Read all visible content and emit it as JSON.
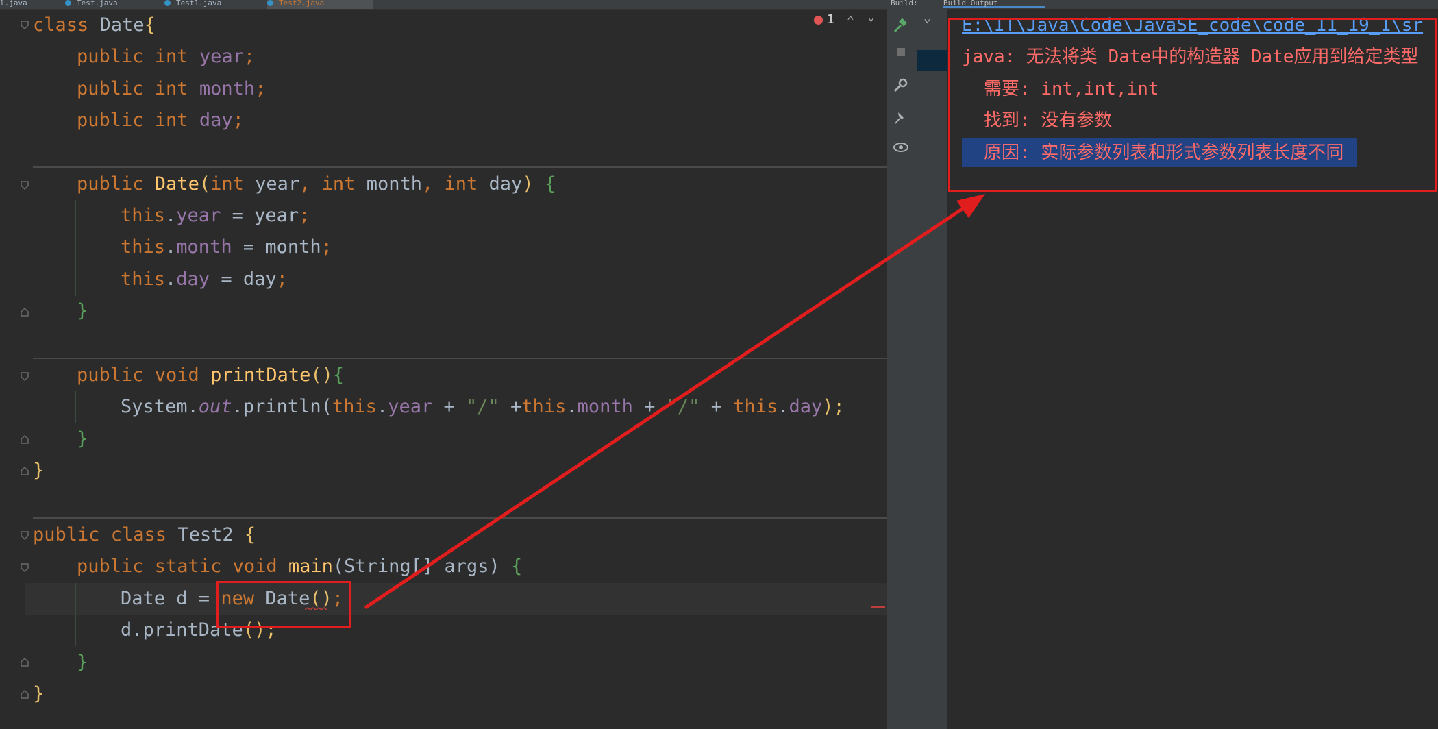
{
  "editor": {
    "tabs": [
      "l.java",
      "Test.java",
      "Test1.java",
      "Test2.java"
    ],
    "error_count": "1",
    "lines": {
      "l1": {
        "a": "class ",
        "b": "Date",
        "c": "{"
      },
      "l2": {
        "a": "public int ",
        "b": "year",
        "c": ";"
      },
      "l3": {
        "a": "public int ",
        "b": "month",
        "c": ";"
      },
      "l4": {
        "a": "public int ",
        "b": "day",
        "c": ";"
      },
      "l6": {
        "a": "public ",
        "b": "Date",
        "c": "(",
        "d": "int ",
        "e": "year",
        "f": ", ",
        "g": "int ",
        "h": "month",
        "i": ", ",
        "j": "int ",
        "k": "day",
        "l": ") ",
        "m": "{"
      },
      "l7": {
        "a": "this",
        "b": ".",
        "c": "year",
        "d": " = year",
        "e": ";"
      },
      "l8": {
        "a": "this",
        "b": ".",
        "c": "month",
        "d": " = month",
        "e": ";"
      },
      "l9": {
        "a": "this",
        "b": ".",
        "c": "day",
        "d": " = day",
        "e": ";"
      },
      "l10": {
        "a": "}"
      },
      "l12": {
        "a": "public void ",
        "b": "printDate",
        "c": "()",
        "d": "{"
      },
      "l13": {
        "a": "System.",
        "b": "out",
        "c": ".println(",
        "d": "this",
        "e": ".",
        "f": "year",
        "g": " + ",
        "h": "\"/\"",
        "i": " +",
        "j": "this",
        "k": ".",
        "l": "month",
        "m": " + ",
        "n": "\"/\"",
        "o": " + ",
        "p": "this",
        "q": ".",
        "r": "day",
        "s": ");"
      },
      "l14": {
        "a": "}"
      },
      "l15": {
        "a": "}"
      },
      "l17": {
        "a": "public class ",
        "b": "Test2",
        "c": " {"
      },
      "l18": {
        "a": "public static void ",
        "b": "main",
        "c": "(String[] args) ",
        "d": "{"
      },
      "l19": {
        "a": "Date d = ",
        "b": "new",
        "c": " Date",
        "d": "()",
        "e": ";"
      },
      "l20": {
        "a": "d.printDate",
        "b": "();"
      },
      "l21": {
        "a": "}"
      },
      "l22": {
        "a": "}"
      }
    }
  },
  "build_output": {
    "tabs": [
      "Build:",
      "Build Output"
    ],
    "path_link": "E:\\IT\\Java\\Code\\JavaSE_code\\code_11_19_1\\sr",
    "error_prefix": "java: ",
    "error_message": "无法将类 Date中的构造器 Date应用到给定类型",
    "required_label": "需要: ",
    "required_value": "int,int,int",
    "found_label": "找到: ",
    "found_value": "没有参数",
    "reason_label": "原因: ",
    "reason_value": "实际参数列表和形式参数列表长度不同"
  },
  "colors": {
    "annotation": "#e21d1d",
    "keyword": "#cc7832",
    "field": "#9876aa",
    "method": "#ffc66d",
    "string": "#6a8759",
    "error_text": "#ff6b68",
    "link": "#589df6",
    "selection": "#214283"
  },
  "icons": [
    "hammer-icon",
    "stop-icon",
    "wrench-icon",
    "pin-icon",
    "eye-icon",
    "chevron-down-icon",
    "chevron-up-icon",
    "error-icon",
    "fold-icon"
  ]
}
